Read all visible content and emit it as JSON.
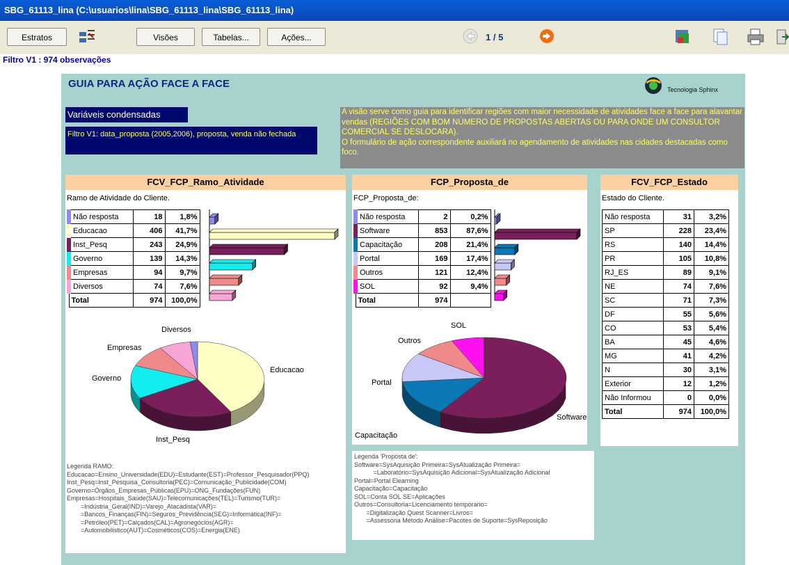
{
  "window": {
    "title": "SBG_61113_lina (C:\\usuarios\\lina\\SBG_61113_lina\\SBG_61113_lina)"
  },
  "toolbar": {
    "estratos": "Estratos",
    "visoes": "Visões",
    "tabelas": "Tabelas...",
    "acoes": "Ações...",
    "page": "1 / 5"
  },
  "filtro_bar": "Filtro V1 : 974 observações",
  "page": {
    "title": "GUIA PARA AÇÃO FACE A FACE",
    "logo_text": "Tecnologia Sphinx",
    "var_cond": "Variáveis condensadas",
    "filtro_desc": "Filtro V1: data_proposta (2005,2006), proposta, venda não fechada",
    "note1": "A visão serve como guia para identificar regiões com maior necessidade de atividades face a face para alavantar vendas (REGIÕES COM BOM NÚMERO DE PROPOSTAS ABERTAS OU PARA ONDE UM CONSULTOR COMERCIAL SE DESLOCARA).",
    "note2": "O formulário de ação correspondente auxiliará no agendamento de atividades nas cidades destacadas como foco."
  },
  "ramo": {
    "title": "FCV_FCP_Ramo_Atividade",
    "subtitle": "Ramo de Atividade do Cliente.",
    "rows": [
      {
        "label": "Não resposta",
        "n": "18",
        "pct": "1,8%",
        "color": "#8c8cf0",
        "v": 1.8
      },
      {
        "label": "Educacao",
        "n": "406",
        "pct": "41,7%",
        "color": "#fdfdc4",
        "v": 41.7
      },
      {
        "label": "Inst_Pesq",
        "n": "243",
        "pct": "24,9%",
        "color": "#7a1f5b",
        "v": 24.9
      },
      {
        "label": "Governo",
        "n": "139",
        "pct": "14,3%",
        "color": "#10eef0",
        "v": 14.3
      },
      {
        "label": "Empresas",
        "n": "94",
        "pct": "9,7%",
        "color": "#f08a8a",
        "v": 9.7
      },
      {
        "label": "Diversos",
        "n": "74",
        "pct": "7,6%",
        "color": "#f7a6d6",
        "v": 7.6
      }
    ],
    "total": {
      "label": "Total",
      "n": "974",
      "pct": "100,0%"
    },
    "pie_labels": [
      "Diversos",
      "Empresas",
      "Governo",
      "Educacao",
      "Inst_Pesq"
    ],
    "legend": "Legenda RAMO:\nEducacao=Ensino_Universidade(EDU)=Estudante(EST)=Professor_Pesquisador(PPQ)\nInst_Pesq=Inst_Pesquisa_Consultoria(PEC)=Comunicação_Publicidade(COM)\nGoverno=Órgãos_Empresas_Públicas(EPU)=ONG_Fundações(FUN)\nEmpresas=Hospitais_Saúde(SAU)=Telecomunicações(TEL)=Turismo(TUR)=\n        =Indústria_Geral(IND)=Varejo_Atacadista(VAR)=\n        =Bancos_Finanças(FIN)=Seguros_Previdência(SEG)=Informática(INF)=\n        =Petróleo(PET)=Calçados(CAL)=Agronegócios(AGR)=\n        =Automobilístico(AUT)=Cosméticos(COS)=Energia(ENE)"
  },
  "proposta": {
    "title": "FCP_Proposta_de",
    "subtitle": "FCP_Proposta_de:",
    "rows": [
      {
        "label": "Não resposta",
        "n": "2",
        "pct": "0,2%",
        "color": "#8c8cf0",
        "v": 0.2
      },
      {
        "label": "Software",
        "n": "853",
        "pct": "87,6%",
        "color": "#7a1f5b",
        "v": 87.6
      },
      {
        "label": "Capacitação",
        "n": "208",
        "pct": "21,4%",
        "color": "#0a78b4",
        "v": 21.4
      },
      {
        "label": "Portal",
        "n": "169",
        "pct": "17,4%",
        "color": "#c8c8f8",
        "v": 17.4
      },
      {
        "label": "Outros",
        "n": "121",
        "pct": "12,4%",
        "color": "#f08a8a",
        "v": 12.4
      },
      {
        "label": "SOL",
        "n": "92",
        "pct": "9,4%",
        "color": "#ff10f0",
        "v": 9.4
      }
    ],
    "total": {
      "label": "Total",
      "n": "974"
    },
    "pie_labels": [
      "SOL",
      "Outros",
      "Portal",
      "Software",
      "Capacitação"
    ],
    "legend": "Legenda 'Proposta de':\nSoftware=SysAquisição Primeira=SysAtualização Primeira=\n           =Laboratório=SysAquisição Adicional=SysAtualização Adicional\nPortal=Portal Elearning\nCapacitação=Capacitação\nSOL=Conta SOL SE=Aplicações\nOutros=Consultoria=Licenciamento temporario=\n       =Digitalização Quest Scanner=Livros=\n       =Assessoria Método Análise=Pacotes de Suporte=SysReposição"
  },
  "estado": {
    "title": "FCV_FCP_Estado",
    "subtitle": "Estado do Cliente.",
    "rows": [
      {
        "label": "Não resposta",
        "n": "31",
        "pct": "3,2%"
      },
      {
        "label": "SP",
        "n": "228",
        "pct": "23,4%"
      },
      {
        "label": "RS",
        "n": "140",
        "pct": "14,4%"
      },
      {
        "label": "PR",
        "n": "105",
        "pct": "10,8%"
      },
      {
        "label": "RJ_ES",
        "n": "89",
        "pct": "9,1%"
      },
      {
        "label": "NE",
        "n": "74",
        "pct": "7,6%"
      },
      {
        "label": "SC",
        "n": "71",
        "pct": "7,3%"
      },
      {
        "label": "DF",
        "n": "55",
        "pct": "5,6%"
      },
      {
        "label": "CO",
        "n": "53",
        "pct": "5,4%"
      },
      {
        "label": "BA",
        "n": "45",
        "pct": "4,6%"
      },
      {
        "label": "MG",
        "n": "41",
        "pct": "4,2%"
      },
      {
        "label": "N",
        "n": "30",
        "pct": "3,1%"
      },
      {
        "label": "Exterior",
        "n": "12",
        "pct": "1,2%"
      },
      {
        "label": "Não Informou",
        "n": "0",
        "pct": "0,0%"
      }
    ],
    "total": {
      "label": "Total",
      "n": "974",
      "pct": "100,0%"
    }
  }
}
